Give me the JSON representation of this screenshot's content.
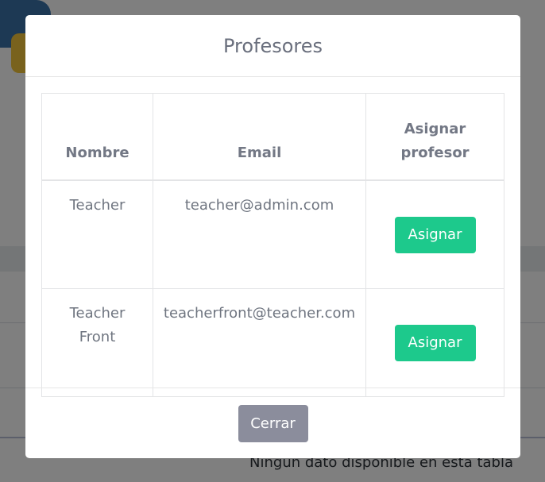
{
  "background": {
    "empty_table_text": "Ningún dato disponible en esta tabla"
  },
  "modal": {
    "title": "Profesores",
    "table": {
      "headers": [
        "Nombre",
        "Email",
        "Asignar profesor"
      ],
      "rows": [
        {
          "name": "Teacher",
          "email": "teacher@admin.com",
          "action_label": "Asignar"
        },
        {
          "name": "Teacher Front",
          "email": "teacherfront@teacher.com",
          "action_label": "Asignar"
        }
      ]
    },
    "close_label": "Cerrar"
  },
  "colors": {
    "assign_button": "#1dc98c",
    "close_button": "#8b8d9c",
    "backdrop": "rgba(0,0,0,0.5)"
  }
}
